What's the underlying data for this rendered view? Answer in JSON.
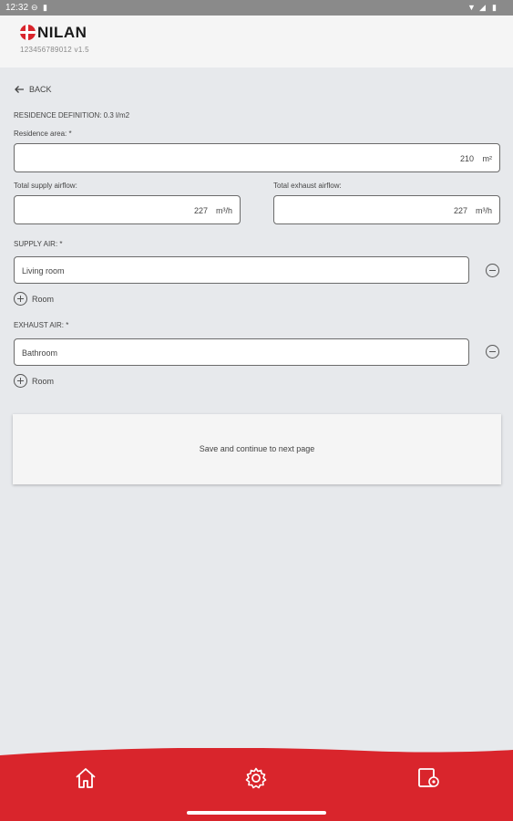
{
  "status_bar": {
    "time": "12:32"
  },
  "header": {
    "logo_text": "NILAN",
    "serial": "123456789012  v1.5"
  },
  "back": {
    "label": "BACK"
  },
  "residence_definition": "RESIDENCE DEFINITION: 0.3 l/m2",
  "residence_area": {
    "label": "Residence area: *",
    "value": "210",
    "unit": "m²"
  },
  "supply_airflow": {
    "label": "Total supply airflow:",
    "value": "227",
    "unit": "m³/h"
  },
  "exhaust_airflow": {
    "label": "Total exhaust airflow:",
    "value": "227",
    "unit": "m³/h"
  },
  "supply_air": {
    "label": "SUPPLY AIR: *",
    "room_value": "Living room",
    "add_label": "Room"
  },
  "exhaust_air": {
    "label": "EXHAUST AIR: *",
    "room_value": "Bathroom",
    "add_label": "Room"
  },
  "save_button": "Save and continue to next page",
  "colors": {
    "brand_red": "#d9252c",
    "background": "#e7e9ec"
  },
  "nav": {
    "icons": [
      "home-icon",
      "settings-gear-icon",
      "device-settings-icon"
    ]
  }
}
